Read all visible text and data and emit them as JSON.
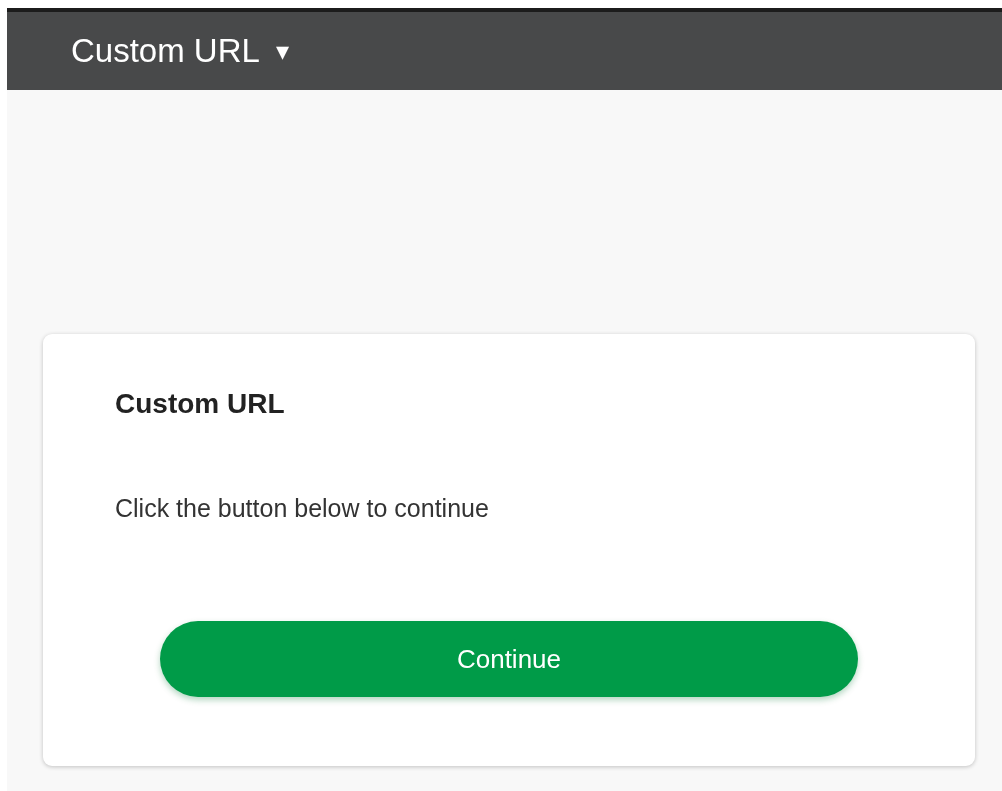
{
  "header": {
    "title": "Custom URL",
    "caret": "▾"
  },
  "card": {
    "title": "Custom URL",
    "message": "Click the button below to continue",
    "button": "Continue"
  }
}
